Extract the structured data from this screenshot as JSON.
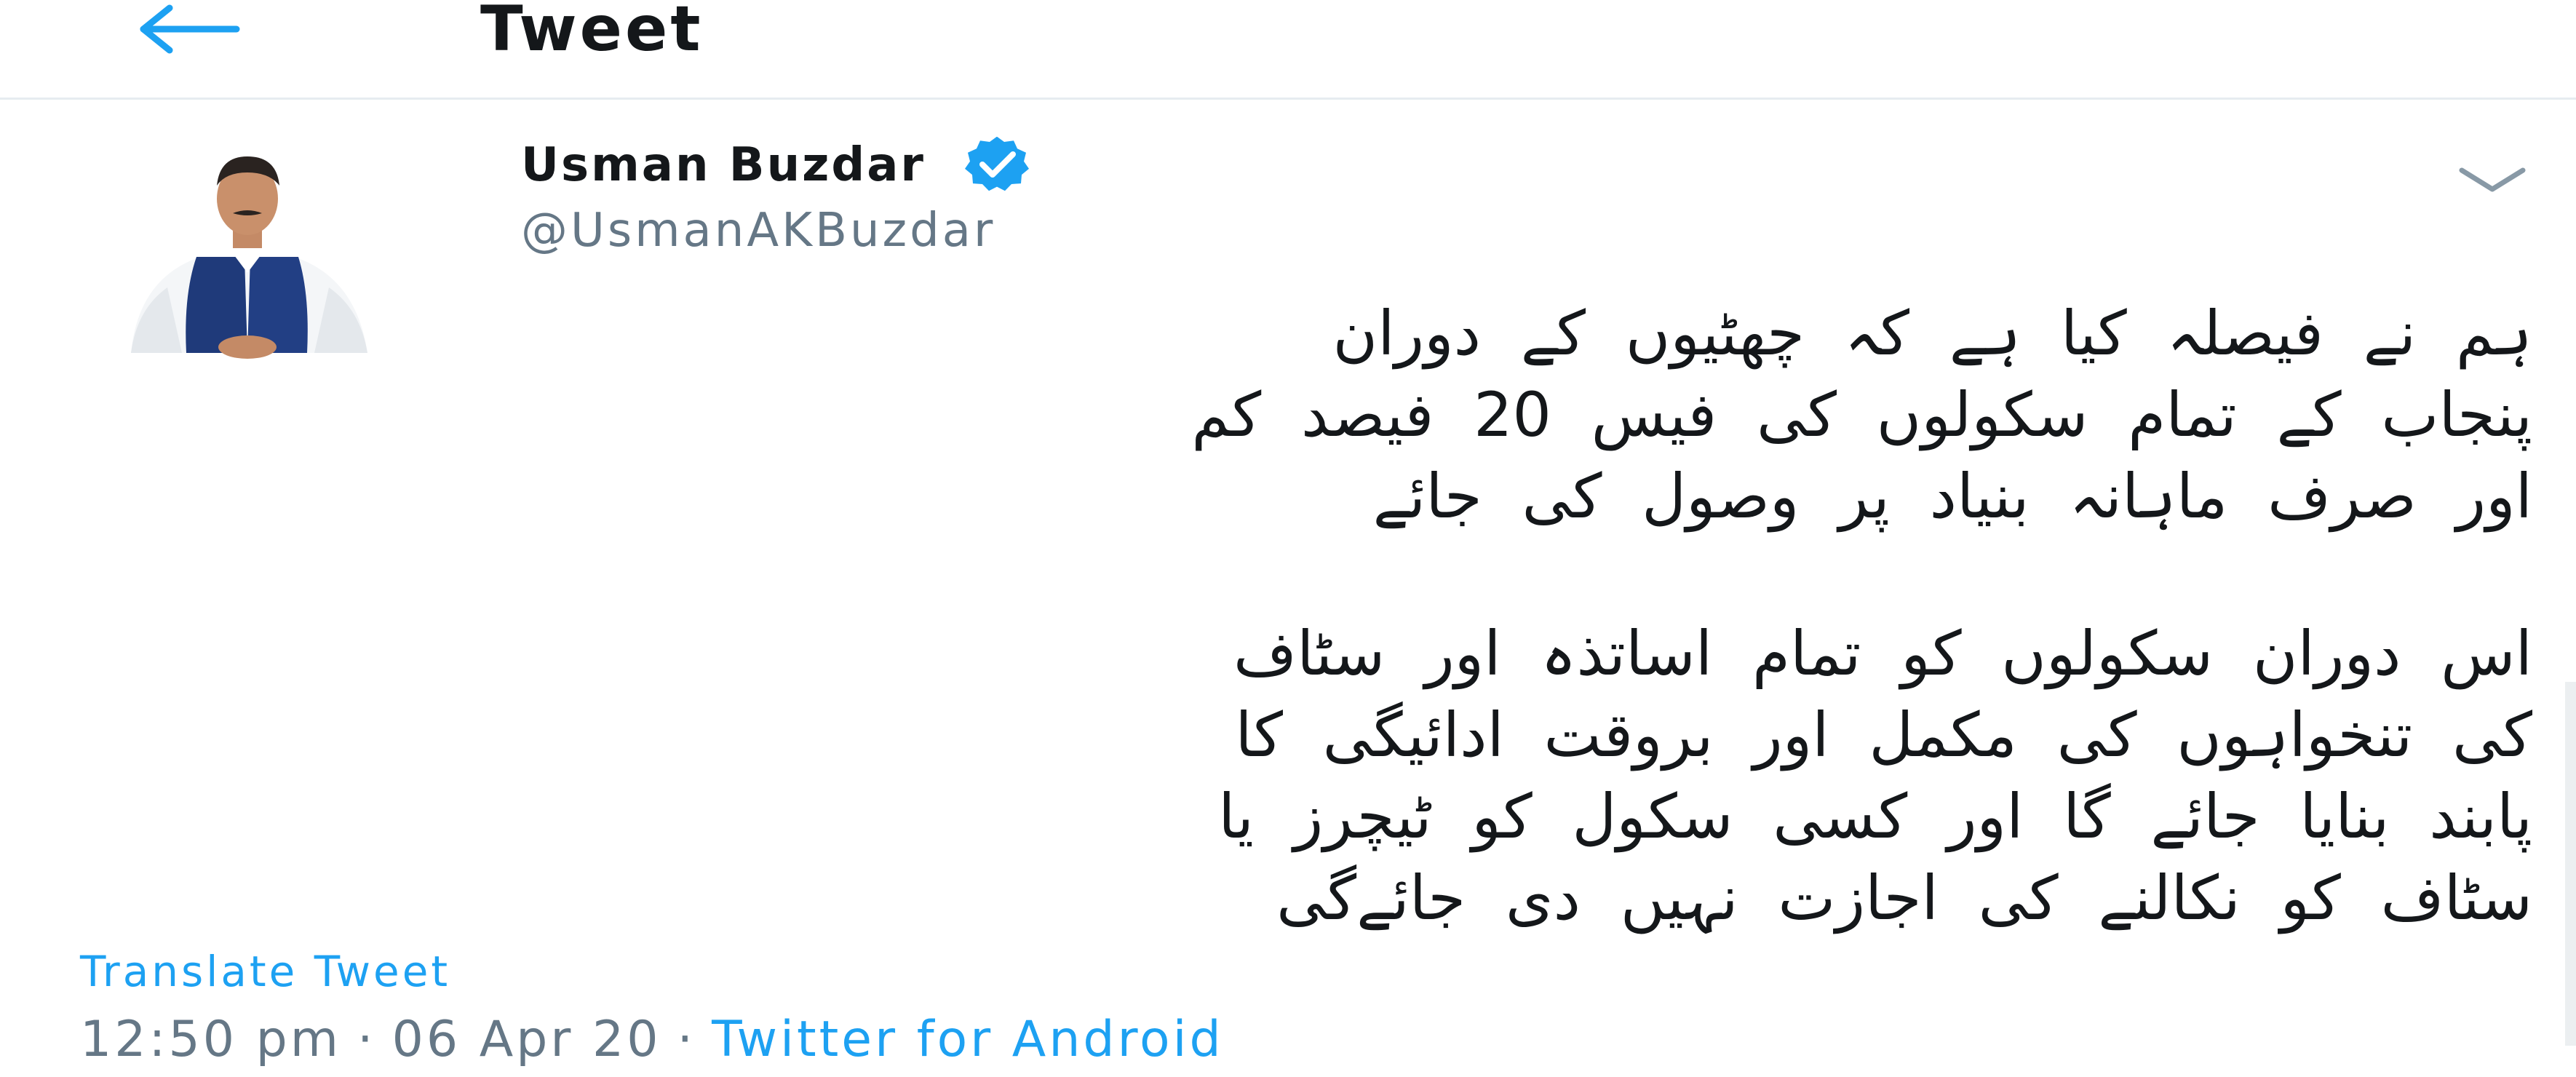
{
  "header": {
    "back_icon": "arrow-left-icon",
    "title": "Tweet"
  },
  "tweet": {
    "author": {
      "name": "Usman Buzdar",
      "handle": "@UsmanAKBuzdar",
      "verified_icon": "verified-badge-icon",
      "avatar_icon": "avatar-photo"
    },
    "menu_icon": "chevron-down-icon",
    "paragraphs": [
      [
        "ہم نے فیصلہ کیا ہے کہ چھٹیوں کے دوران",
        "پنجاب کے تمام سکولوں کی فیس 20 فیصد کم",
        "اور صرف ماہانہ بنیاد پر وصول کی جائے"
      ],
      [
        "اس دوران سکولوں کو تمام اساتذہ اور سٹاف",
        "کی تنخواہوں کی مکمل اور بروقت ادائیگی کا",
        "پابند بنایا جائے گا اور کسی سکول کو ٹیچرز یا",
        "سٹاف کو نکالنے کی اجازت نہیں دی جائےگی"
      ]
    ],
    "translate_label": "Translate Tweet",
    "time": "12:50 pm",
    "separator": "·",
    "date": "06 Apr 20",
    "source": "Twitter for Android"
  },
  "colors": {
    "accent": "#1da1f2",
    "text": "#14171a",
    "muted": "#657786",
    "divider": "#e6ecf0",
    "verified": "#1da1f2"
  }
}
